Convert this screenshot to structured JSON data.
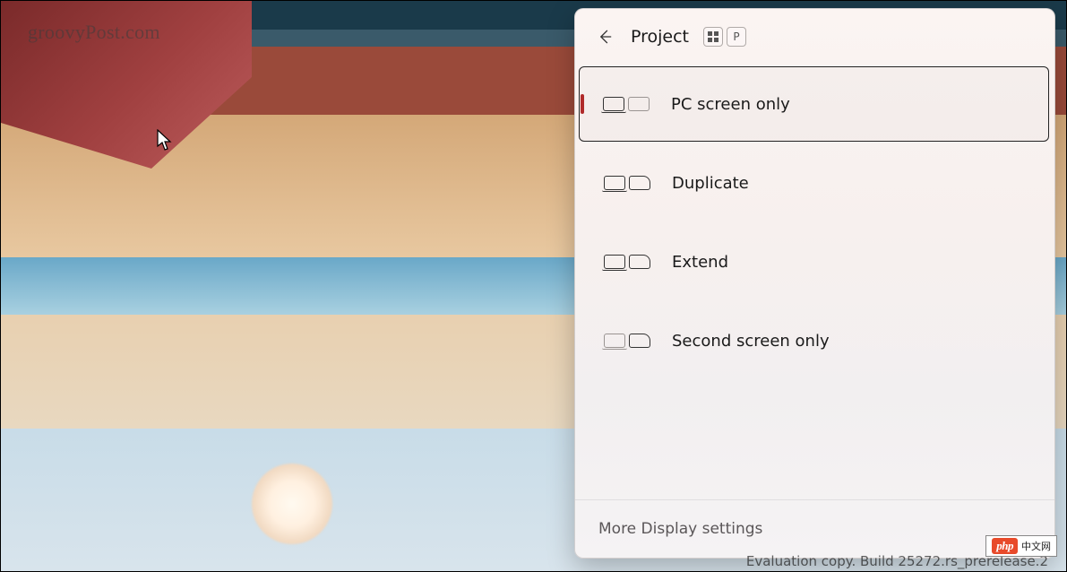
{
  "watermark": "groovyPost.com",
  "panel": {
    "title": "Project",
    "shortcut_keys": [
      "win",
      "P"
    ],
    "options": [
      {
        "id": "pc-only",
        "label": "PC screen only",
        "selected": true,
        "mode": "pc_only"
      },
      {
        "id": "duplicate",
        "label": "Duplicate",
        "selected": false,
        "mode": "duplicate"
      },
      {
        "id": "extend",
        "label": "Extend",
        "selected": false,
        "mode": "extend"
      },
      {
        "id": "second",
        "label": "Second screen only",
        "selected": false,
        "mode": "second_only"
      }
    ],
    "footer_link": "More Display settings"
  },
  "desktop": {
    "evaluation_text": "Evaluation copy. Build 25272.rs_prerelease.2"
  },
  "badge": {
    "brand": "php",
    "suffix": "中文网"
  }
}
